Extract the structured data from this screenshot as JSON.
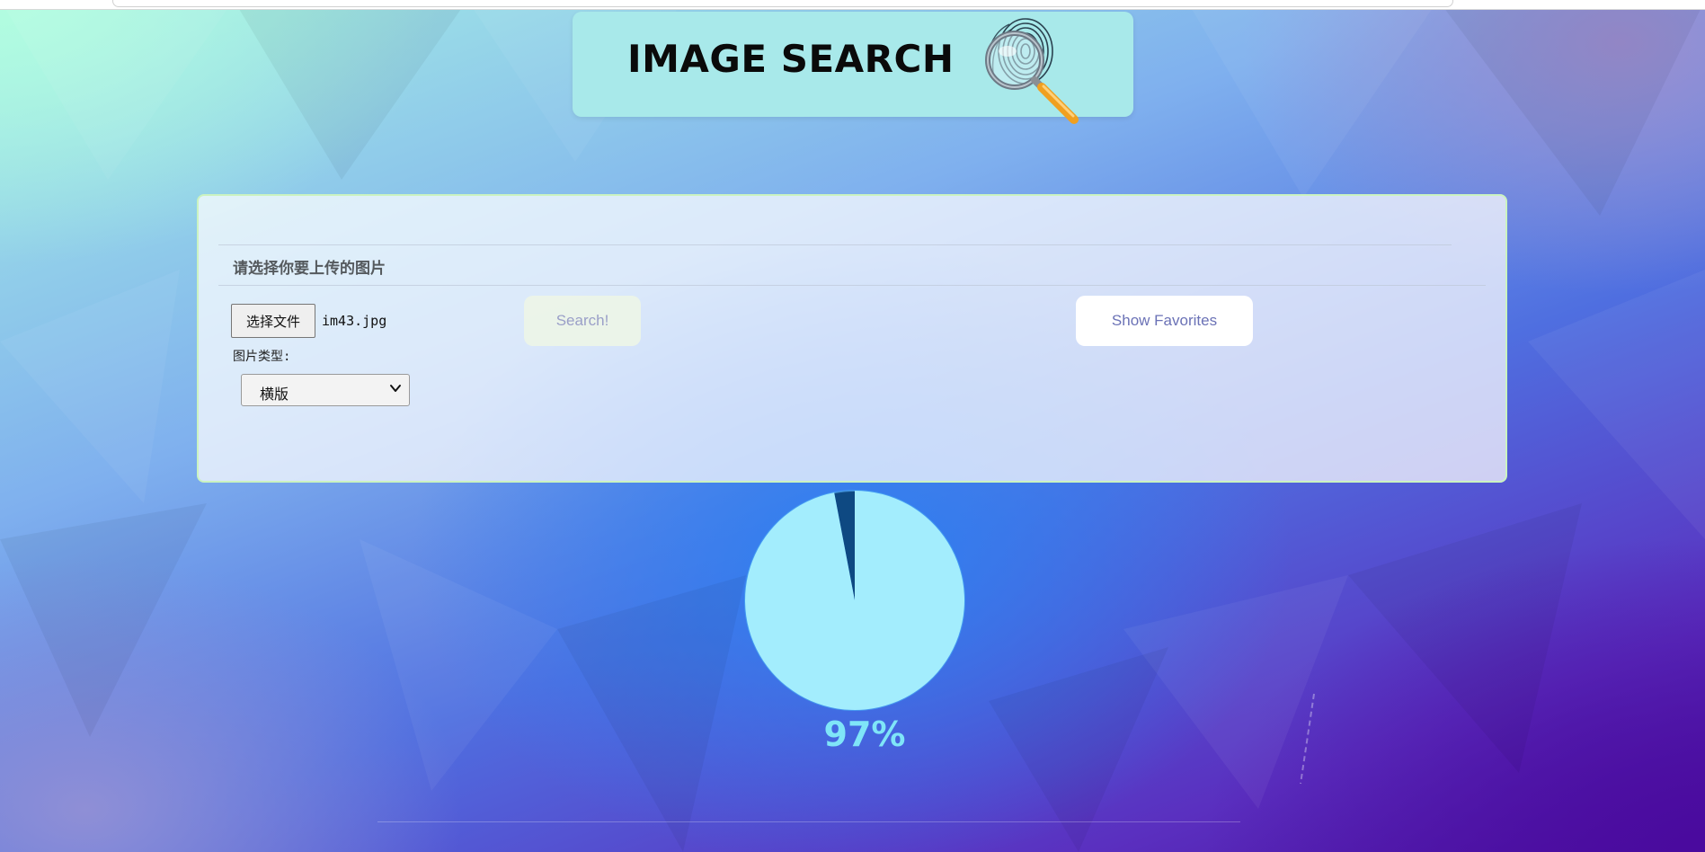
{
  "header": {
    "title": "IMAGE SEARCH",
    "logo_icon": "fingerprint-magnifier-icon"
  },
  "upload": {
    "section_label": "请选择你要上传的图片",
    "choose_file_label": "选择文件",
    "file_name": "im43.jpg",
    "type_label": "图片类型:",
    "type_selected": "横版"
  },
  "actions": {
    "search_label": "Search!",
    "favorites_label": "Show Favorites"
  },
  "progress": {
    "value": 0.97,
    "text": "97%"
  },
  "colors": {
    "header_bg": "#a8e9ea",
    "progress_fill": "#a3edfd",
    "progress_text": "#7fe5f8",
    "panel_border": "#cbf3c0"
  }
}
